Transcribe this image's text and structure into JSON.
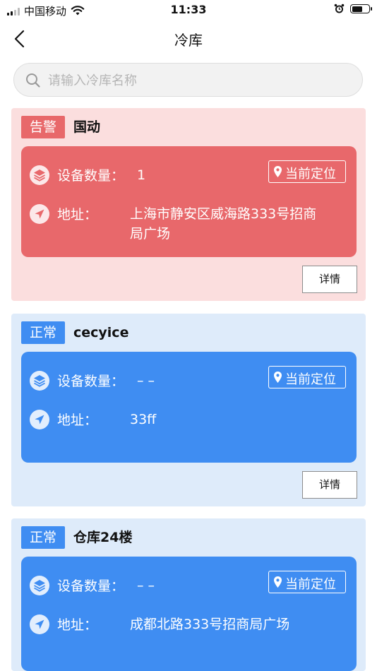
{
  "status_bar": {
    "carrier": "中国移动",
    "time": "11:33"
  },
  "nav": {
    "title": "冷库"
  },
  "search": {
    "placeholder": "请输入冷库名称"
  },
  "labels": {
    "device_count": "设备数量：",
    "address": "地址：",
    "locate": "当前定位",
    "detail": "详情"
  },
  "cards": [
    {
      "status": "告警",
      "name": "国动",
      "device_count": "1",
      "address_line1": "上海市静安区威海路333号招商",
      "address_line2": "局广场"
    },
    {
      "status": "正常",
      "name": "cecyice",
      "device_count": "– –",
      "address_line1": "33ff",
      "address_line2": ""
    },
    {
      "status": "正常",
      "name": "仓库24楼",
      "device_count": "– –",
      "address_line1": "成都北路333号招商局广场",
      "address_line2": ""
    }
  ],
  "colors": {
    "alarm_bg": "#fbdede",
    "alarm_accent": "#e8686b",
    "normal_bg": "#deebfa",
    "normal_accent": "#3f8df2"
  }
}
